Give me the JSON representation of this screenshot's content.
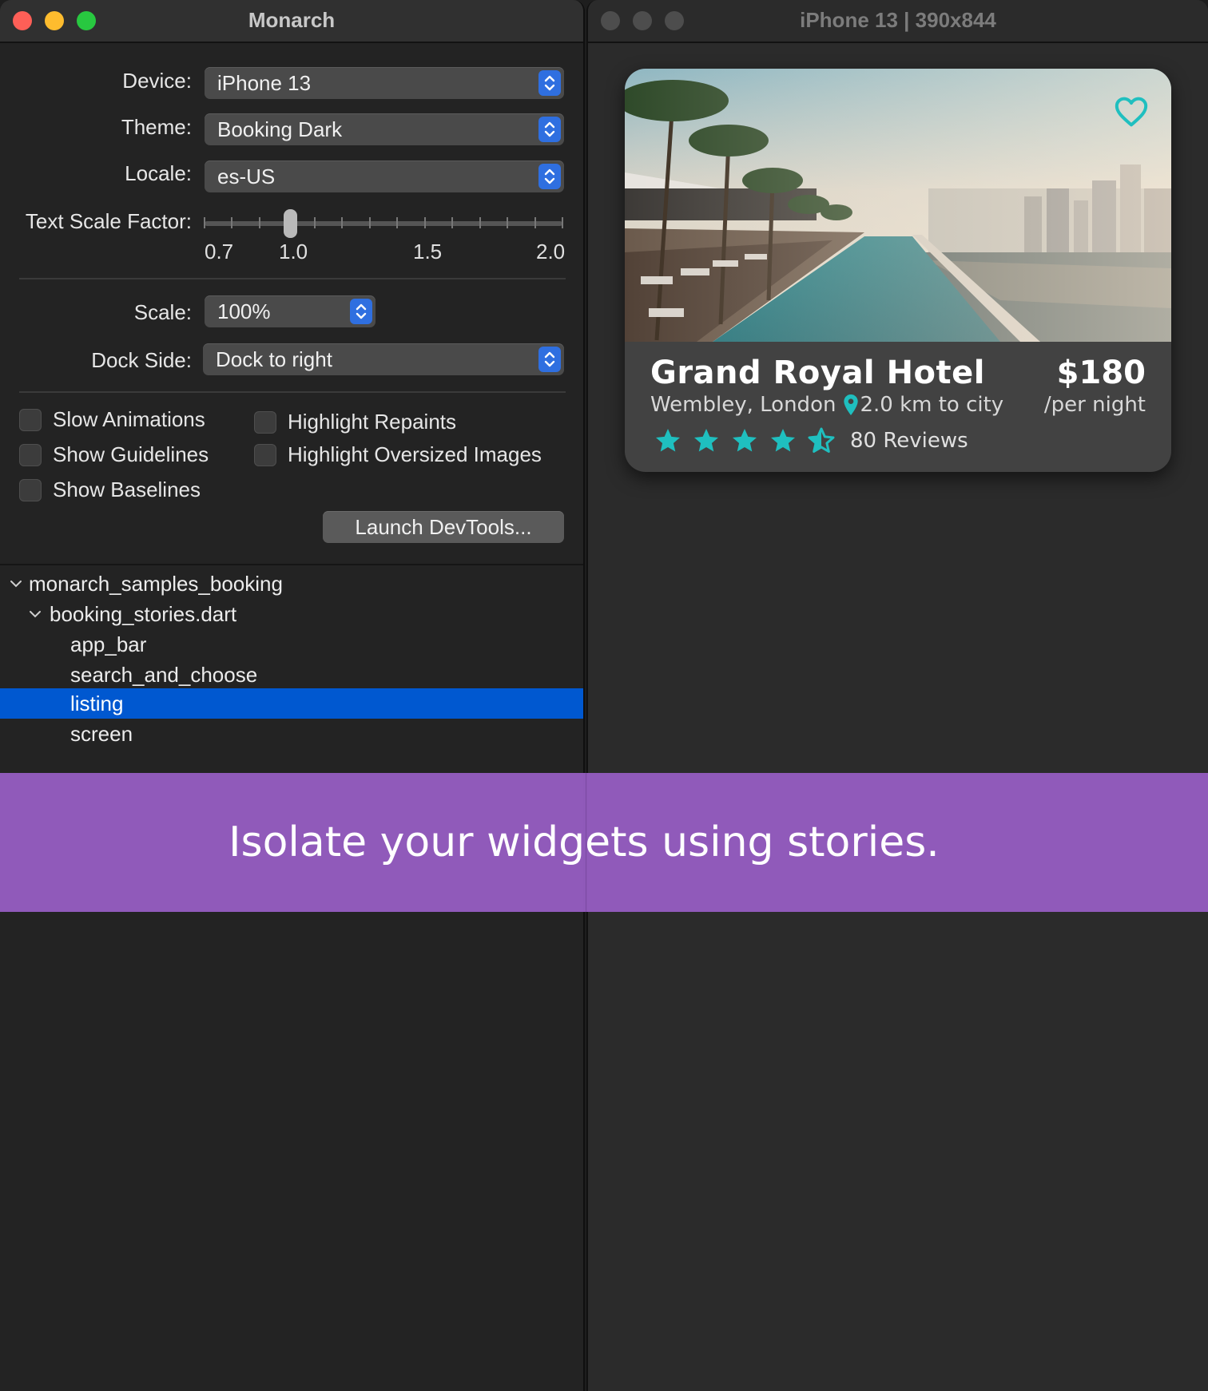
{
  "left_window": {
    "title": "Monarch",
    "form": {
      "device": {
        "label": "Device:",
        "value": "iPhone 13"
      },
      "theme": {
        "label": "Theme:",
        "value": "Booking Dark"
      },
      "locale": {
        "label": "Locale:",
        "value": "es-US"
      },
      "text_scale": {
        "label": "Text Scale Factor:",
        "value": 1.0,
        "min": 0.7,
        "max": 2.0,
        "tick_labels": [
          "0.7",
          "1.0",
          "1.5",
          "2.0"
        ]
      },
      "scale": {
        "label": "Scale:",
        "value": "100%"
      },
      "dock_side": {
        "label": "Dock Side:",
        "value": "Dock to right"
      }
    },
    "checkboxes": [
      {
        "label": "Slow Animations",
        "checked": false
      },
      {
        "label": "Highlight Repaints",
        "checked": false
      },
      {
        "label": "Show Guidelines",
        "checked": false
      },
      {
        "label": "Highlight Oversized Images",
        "checked": false
      },
      {
        "label": "Show Baselines",
        "checked": false
      }
    ],
    "launch_button": "Launch DevTools...",
    "tree": {
      "package": "monarch_samples_booking",
      "file": "booking_stories.dart",
      "stories": [
        "app_bar",
        "search_and_choose",
        "listing",
        "screen"
      ],
      "selected": "listing"
    }
  },
  "right_window": {
    "title": "iPhone 13 | 390x844",
    "card": {
      "name": "Grand Royal Hotel",
      "location": "Wembley, London",
      "distance": "2.0 km to city",
      "price": "$180",
      "per_night": "/per night",
      "rating": 4.5,
      "reviews": "80 Reviews",
      "accent_color": "#1fbfbf",
      "icons": [
        "heart-outline-icon",
        "location-pin-icon",
        "star-icon",
        "star-half-icon"
      ]
    }
  },
  "banner": {
    "text": "Isolate your widgets using stories.",
    "color": "#945cbf"
  },
  "colors": {
    "traffic_red": "#fe5f57",
    "traffic_yellow": "#febc2e",
    "traffic_green": "#28c840",
    "selection": "#0058d0",
    "stepper": "#2f6fe0"
  }
}
